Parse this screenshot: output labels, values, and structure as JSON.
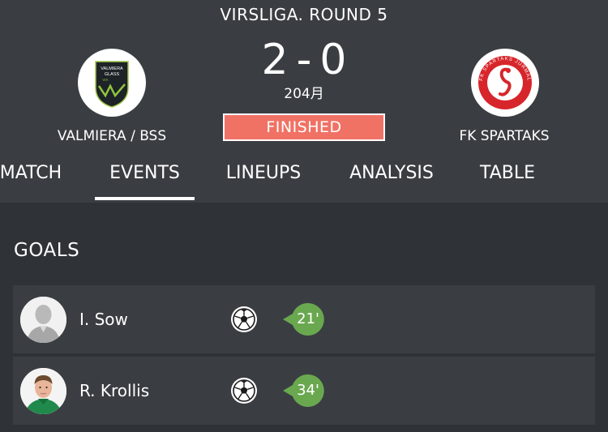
{
  "match": {
    "round": "VIRSLIGA. ROUND 5",
    "home_team": "VALMIERA / BSS",
    "away_team": "FK SPARTAKS",
    "home_score": "2",
    "separator": "-",
    "away_score": "0",
    "date": "204月",
    "status": "FINISHED",
    "home_logo_text": [
      "VALMIERA",
      "GLASS",
      "VIA"
    ],
    "away_logo_text": "FK SPARTAKS JŪRMALA"
  },
  "tabs": [
    {
      "label": "MATCH",
      "active": false
    },
    {
      "label": "EVENTS",
      "active": true
    },
    {
      "label": "LINEUPS",
      "active": false
    },
    {
      "label": "ANALYSIS",
      "active": false
    },
    {
      "label": "TABLE",
      "active": false
    }
  ],
  "goals": {
    "title": "GOALS",
    "items": [
      {
        "player": "I. Sow",
        "minute": "21'",
        "icon": "soccer-ball-icon",
        "avatar": "placeholder-silhouette"
      },
      {
        "player": "R. Krollis",
        "minute": "34'",
        "icon": "soccer-ball-icon",
        "avatar": "player-photo"
      }
    ]
  },
  "colors": {
    "background": "#2f3337",
    "header": "#3a3e42",
    "status_badge": "#f07265",
    "minute_badge": "#6aa84f",
    "away_logo_red": "#d7262b"
  }
}
